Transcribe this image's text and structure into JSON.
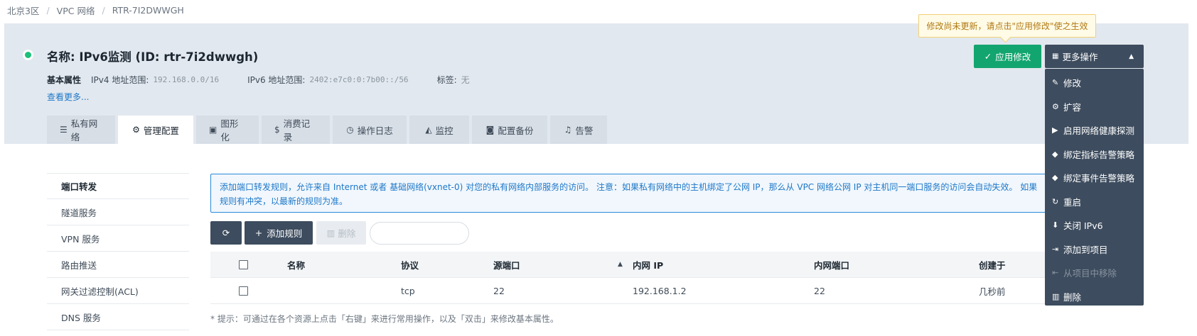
{
  "breadcrumb": [
    "北京3区",
    "VPC 网络",
    "RTR-7I2DWWGH"
  ],
  "router": {
    "title": "名称: IPv6监测 (ID: rtr-7i2dwwgh)",
    "status_color": "#1ec07a",
    "attrs_head": "基本属性",
    "ipv4_label": "IPv4 地址范围:",
    "ipv4_value": "192.168.0.0/16",
    "ipv6_label": "IPv6 地址范围:",
    "ipv6_value": "2402:e7c0:0:7b00::/56",
    "tag_label": "标签:",
    "tag_value": "无",
    "more_link": "查看更多..."
  },
  "tabs": [
    {
      "label": "私有网络",
      "icon": "list-icon"
    },
    {
      "label": "管理配置",
      "icon": "gears-icon",
      "active": true
    },
    {
      "label": "图形化",
      "icon": "image-icon"
    },
    {
      "label": "消费记录",
      "icon": "dollar-icon"
    },
    {
      "label": "操作日志",
      "icon": "clock-icon"
    },
    {
      "label": "监控",
      "icon": "area-chart-icon"
    },
    {
      "label": "配置备份",
      "icon": "camera-icon"
    },
    {
      "label": "告警",
      "icon": "bell-icon"
    }
  ],
  "side_menu": [
    "端口转发",
    "隧道服务",
    "VPN 服务",
    "路由推送",
    "网关过滤控制(ACL)",
    "DNS 服务"
  ],
  "notice": "添加端口转发规则，允许来自 Internet 或者 基础网络(vxnet-0) 对您的私有网络内部服务的访问。 注意：如果私有网络中的主机绑定了公网 IP，那么从 VPC 网络公网 IP 对主机同一端口服务的访问会自动失效。 如果规则有冲突，以最新的规则为准。",
  "toolbar": {
    "add_label": "添加规则",
    "delete_label": "删除",
    "search_placeholder": ""
  },
  "table": {
    "headers": [
      "名称",
      "协议",
      "源端口",
      "内网 IP",
      "内网端口",
      "创建于"
    ],
    "rows": [
      {
        "name": "",
        "protocol": "tcp",
        "src_port": "22",
        "inner_ip": "192.168.1.2",
        "inner_port": "22",
        "created": "几秒前"
      }
    ]
  },
  "hint": "* 提示：可通过在各个资源上点击「右键」来进行常用操作，以及「双击」来修改基本属性。",
  "actions": {
    "tooltip": "修改尚未更新，请点击\"应用修改\"使之生效",
    "apply_label": "应用修改",
    "more_label": "更多操作",
    "apply_color": "#13a570",
    "menu_bg": "#3d4c5e"
  },
  "dropdown": [
    {
      "label": "修改",
      "icon": "pencil-icon"
    },
    {
      "label": "扩容",
      "icon": "gear-icon"
    },
    {
      "label": "启用网络健康探测",
      "icon": "play-icon"
    },
    {
      "label": "绑定指标告警策略",
      "icon": "alert-policy-icon"
    },
    {
      "label": "绑定事件告警策略",
      "icon": "alert-policy-icon"
    },
    {
      "label": "重启",
      "icon": "refresh-icon"
    },
    {
      "label": "关闭 IPv6",
      "icon": "arrow-down-icon"
    },
    {
      "label": "添加到项目",
      "icon": "sign-in-icon"
    },
    {
      "label": "从项目中移除",
      "icon": "sign-out-icon",
      "disabled": true
    },
    {
      "label": "删除",
      "icon": "trash-icon"
    }
  ]
}
